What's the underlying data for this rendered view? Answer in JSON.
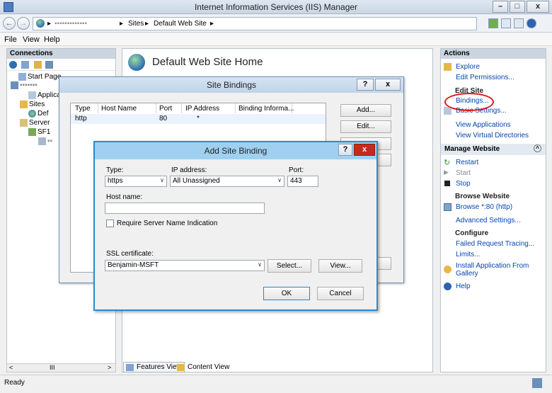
{
  "window": {
    "title": "Internet Information Services (IIS) Manager",
    "min": "–",
    "max": "□",
    "close": "x"
  },
  "address": {
    "redacted": "▪▪▪▪▪▪▪▪▪▪▪▪▪",
    "crumb1": "Sites",
    "crumb2": "Default Web Site",
    "sep": "▸"
  },
  "menu": {
    "file": "File",
    "view": "View",
    "help": "Help"
  },
  "connections": {
    "header": "Connections",
    "tree": [
      {
        "label": "Start Page"
      },
      {
        "label": "▪▪▪▪▪▪▪"
      },
      {
        "label": "Applica"
      },
      {
        "label": "Sites"
      },
      {
        "label": "Def"
      },
      {
        "label": "Server"
      },
      {
        "label": "SF1"
      },
      {
        "label": "▪▪"
      }
    ],
    "scroll_mid": "III"
  },
  "center": {
    "title": "Default Web Site Home",
    "tab_features": "Features View",
    "tab_content": "Content View"
  },
  "actions": {
    "header": "Actions",
    "explore": "Explore",
    "edit_permissions": "Edit Permissions...",
    "edit_site": "Edit Site",
    "bindings": "Bindings...",
    "basic_settings": "Basic Settings...",
    "view_applications": "View Applications",
    "view_virtual_dirs": "View Virtual Directories",
    "manage_website": "Manage Website",
    "restart": "Restart",
    "start": "Start",
    "stop": "Stop",
    "browse_website": "Browse Website",
    "browse_80": "Browse *:80 (http)",
    "advanced_settings": "Advanced Settings...",
    "configure": "Configure",
    "failed_request_tracing": "Failed Request Tracing...",
    "limits": "Limits...",
    "install_app_gallery_1": "Install Application From",
    "install_app_gallery_2": "Gallery",
    "help": "Help"
  },
  "status": {
    "text": "Ready"
  },
  "site_bindings": {
    "title": "Site Bindings",
    "help_btn": "?",
    "close_btn": "x",
    "columns": [
      "Type",
      "Host Name",
      "Port",
      "IP Address",
      "Binding Informa..."
    ],
    "rows": [
      [
        "http",
        "",
        "80",
        "*",
        ""
      ]
    ],
    "add_btn": "Add...",
    "edit_btn": "Edit..."
  },
  "add_site_binding": {
    "title": "Add Site Binding",
    "help_btn": "?",
    "close_btn": "x",
    "type_label": "Type:",
    "type_value": "https",
    "ip_label": "IP address:",
    "ip_value": "All Unassigned",
    "port_label": "Port:",
    "port_value": "443",
    "host_label": "Host name:",
    "host_value": "",
    "sni_label": "Require Server Name Indication",
    "ssl_label": "SSL certificate:",
    "ssl_value": "Benjamin-MSFT",
    "select_btn": "Select...",
    "view_btn": "View...",
    "ok_btn": "OK",
    "cancel_btn": "Cancel"
  },
  "colors": {
    "highlight_circle": "#e0141b",
    "link": "#0645ad",
    "dialog_border": "#2a8cd0"
  }
}
